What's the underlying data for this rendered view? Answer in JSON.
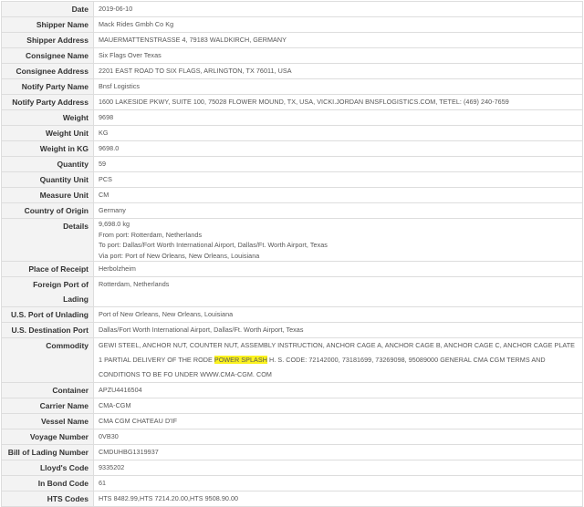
{
  "rows": [
    {
      "label": "Date",
      "value": "2019-06-10"
    },
    {
      "label": "Shipper Name",
      "value": "Mack Rides Gmbh Co Kg"
    },
    {
      "label": "Shipper Address",
      "value": "MAUERMATTENSTRASSE 4, 79183 WALDKIRCH, GERMANY"
    },
    {
      "label": "Consignee Name",
      "value": "Six Flags Over Texas"
    },
    {
      "label": "Consignee Address",
      "value": "2201 EAST ROAD TO SIX FLAGS, ARLINGTON, TX 76011, USA"
    },
    {
      "label": "Notify Party Name",
      "value": "Bnsf Logistics"
    },
    {
      "label": "Notify Party Address",
      "value": "1600 LAKESIDE PKWY, SUITE 100, 75028 FLOWER MOUND, TX, USA, VICKI.JORDAN BNSFLOGISTICS.COM, TETEL: (469) 240-7659"
    },
    {
      "label": "Weight",
      "value": "9698"
    },
    {
      "label": "Weight Unit",
      "value": "KG"
    },
    {
      "label": "Weight in KG",
      "value": "9698.0"
    },
    {
      "label": "Quantity",
      "value": "59"
    },
    {
      "label": "Quantity Unit",
      "value": "PCS"
    },
    {
      "label": "Measure Unit",
      "value": "CM"
    },
    {
      "label": "Country of Origin",
      "value": "Germany"
    }
  ],
  "details": {
    "label": "Details",
    "lines": [
      "9,698.0 kg",
      "From port: Rotterdam, Netherlands",
      "To port: Dallas/Fort Worth International Airport, Dallas/Ft. Worth Airport, Texas",
      "Via port: Port of New Orleans, New Orleans, Louisiana"
    ]
  },
  "rows2": [
    {
      "label": "Place of Receipt",
      "value": "Herbolzheim"
    },
    {
      "label": "Foreign Port of Lading",
      "value": "Rotterdam, Netherlands"
    },
    {
      "label": "U.S. Port of Unlading",
      "value": "Port of New Orleans, New Orleans, Louisiana"
    },
    {
      "label": "U.S. Destination Port",
      "value": "Dallas/Fort Worth International Airport, Dallas/Ft. Worth Airport, Texas"
    }
  ],
  "commodity": {
    "label": "Commodity",
    "before": "GEWI STEEL, ANCHOR NUT, COUNTER NUT, ASSEMBLY INSTRUCTION, ANCHOR CAGE A, ANCHOR CAGE B, ANCHOR CAGE C, ANCHOR CAGE PLATE 1 PARTIAL DELIVERY OF THE RODE ",
    "highlight": "POWER SPLASH",
    "after": " H. S. CODE: 72142000, 73181699, 73269098, 95089000 GENERAL CMA CGM TERMS AND CONDITIONS TO BE FO UNDER WWW.CMA-CGM. COM"
  },
  "rows3": [
    {
      "label": "Container",
      "value": "APZU4416504"
    },
    {
      "label": "Carrier Name",
      "value": "CMA-CGM"
    },
    {
      "label": "Vessel Name",
      "value": "CMA CGM CHATEAU D'IF"
    },
    {
      "label": "Voyage Number",
      "value": "0VB30"
    },
    {
      "label": "Bill of Lading Number",
      "value": "CMDUHBG1319937"
    },
    {
      "label": "Lloyd's Code",
      "value": "9335202"
    },
    {
      "label": "In Bond Code",
      "value": "61"
    },
    {
      "label": "HTS Codes",
      "value": "HTS 8482.99,HTS 7214.20.00,HTS 9508.90.00"
    }
  ],
  "colors": {
    "label_bg": "#f3f3f3",
    "border": "#dddddd",
    "highlight": "#fbf21f"
  }
}
